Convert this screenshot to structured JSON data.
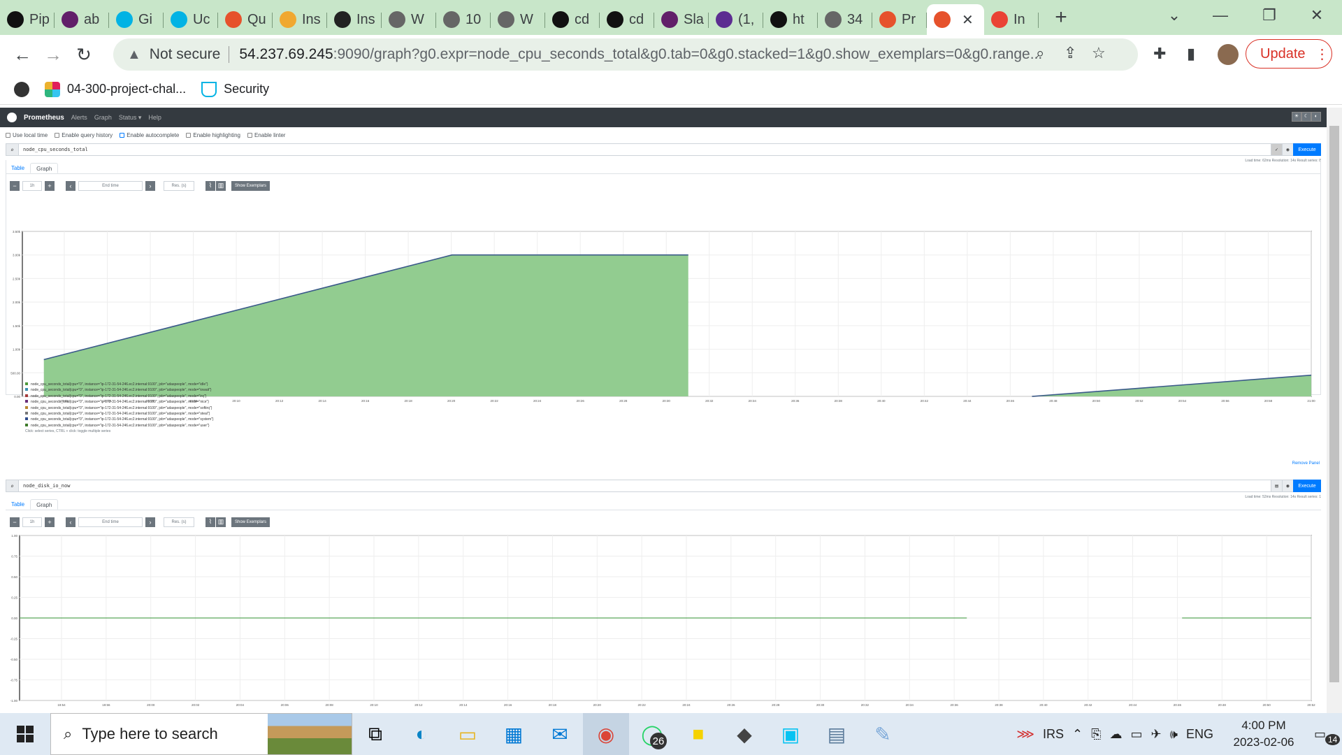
{
  "browser": {
    "tabs": [
      {
        "label": "Pip",
        "icon": "prometheus-like-icon"
      },
      {
        "label": "ab",
        "icon": "slack-icon"
      },
      {
        "label": "Gi",
        "icon": "udacity-icon"
      },
      {
        "label": "Uc",
        "icon": "udacity-icon"
      },
      {
        "label": "Qu",
        "icon": "prometheus-icon"
      },
      {
        "label": "Ins",
        "icon": "aws-box-icon"
      },
      {
        "label": "Ins",
        "icon": "terminal-icon"
      },
      {
        "label": "W",
        "icon": "globe-icon"
      },
      {
        "label": "10",
        "icon": "globe-icon"
      },
      {
        "label": "W",
        "icon": "globe-icon"
      },
      {
        "label": "cd",
        "icon": "github-icon"
      },
      {
        "label": "cd",
        "icon": "github-icon"
      },
      {
        "label": "Sla",
        "icon": "slack-icon"
      },
      {
        "label": "(1,",
        "icon": "mail-icon"
      },
      {
        "label": "ht",
        "icon": "k-icon"
      },
      {
        "label": "34",
        "icon": "globe-icon"
      },
      {
        "label": "Pr",
        "icon": "prometheus-icon"
      },
      {
        "label": "",
        "icon": "prometheus-icon"
      },
      {
        "label": "In",
        "icon": "gmail-icon"
      }
    ],
    "new_tab": "+",
    "omnibox": {
      "security": "Not secure",
      "host": "54.237.69.245",
      "rest": ":9090/graph?g0.expr=node_cpu_seconds_total&g0.tab=0&g0.stacked=1&g0.show_exemplars=0&g0.range..."
    },
    "update_label": "Update",
    "bookmarks": [
      {
        "label": "",
        "icon": "globe-icon"
      },
      {
        "label": "04-300-project-chal...",
        "icon": "slack-icon"
      },
      {
        "label": "Security",
        "icon": "udacity-icon"
      }
    ]
  },
  "prometheus": {
    "nav": {
      "brand": "Prometheus",
      "links": [
        "Alerts",
        "Graph",
        "Status ▾",
        "Help"
      ]
    },
    "options": [
      "Use local time",
      "Enable query history",
      "Enable autocomplete",
      "Enable highlighting",
      "Enable linter"
    ],
    "panels": [
      {
        "query": "node_cpu_seconds_total",
        "execute": "Execute",
        "stats": "Load time: 62ms   Resolution: 14s   Result series: 8",
        "tabs": [
          "Table",
          "Graph"
        ],
        "range": "1h",
        "end_time_placeholder": "End time",
        "res_placeholder": "Res. (s)",
        "exemplars": "Show Exemplars",
        "legend": [
          {
            "text": "node_cpu_seconds_total{cpu=\"0\", instance=\"ip-172-31-54-246.ec2.internal:9100\", job=\"udaspeople\", mode=\"idle\"}",
            "color": "#4e9a3c"
          },
          {
            "text": "node_cpu_seconds_total{cpu=\"0\", instance=\"ip-172-31-54-246.ec2.internal:9100\", job=\"udaspeople\", mode=\"iowait\"}",
            "color": "#3a8fb0"
          },
          {
            "text": "node_cpu_seconds_total{cpu=\"0\", instance=\"ip-172-31-54-246.ec2.internal:9100\", job=\"udaspeople\", mode=\"irq\"}",
            "color": "#a63c3c"
          },
          {
            "text": "node_cpu_seconds_total{cpu=\"0\", instance=\"ip-172-31-54-246.ec2.internal:9100\", job=\"udaspeople\", mode=\"nice\"}",
            "color": "#6a2f7a"
          },
          {
            "text": "node_cpu_seconds_total{cpu=\"0\", instance=\"ip-172-31-54-246.ec2.internal:9100\", job=\"udaspeople\", mode=\"softirq\"}",
            "color": "#b8872f"
          },
          {
            "text": "node_cpu_seconds_total{cpu=\"0\", instance=\"ip-172-31-54-246.ec2.internal:9100\", job=\"udaspeople\", mode=\"steal\"}",
            "color": "#777777"
          },
          {
            "text": "node_cpu_seconds_total{cpu=\"0\", instance=\"ip-172-31-54-246.ec2.internal:9100\", job=\"udaspeople\", mode=\"system\"}",
            "color": "#2d4a8a"
          },
          {
            "text": "node_cpu_seconds_total{cpu=\"0\", instance=\"ip-172-31-54-246.ec2.internal:9100\", job=\"udaspeople\", mode=\"user\"}",
            "color": "#3d7a2a"
          }
        ],
        "legend_hint": "Click: select series, CTRL + click: toggle multiple series",
        "remove": "Remove Panel"
      },
      {
        "query": "node_disk_io_now",
        "execute": "Execute",
        "stats": "Load time: 52ms   Resolution: 14s   Result series: 1",
        "tabs": [
          "Table",
          "Graph"
        ],
        "range": "1h",
        "end_time_placeholder": "End time",
        "res_placeholder": "Res. (s)",
        "exemplars": "Show Exemplars"
      }
    ]
  },
  "chart_data": [
    {
      "type": "area",
      "title": "",
      "x": [
        "20:02",
        "20:04",
        "20:06",
        "20:08",
        "20:10",
        "20:12",
        "20:14",
        "20:16",
        "20:18",
        "20:20",
        "20:22",
        "20:24",
        "20:26",
        "20:28",
        "20:30",
        "20:32",
        "20:34",
        "20:36",
        "20:38",
        "20:40",
        "20:42",
        "20:44",
        "20:46",
        "20:48",
        "20:50",
        "20:52",
        "20:54",
        "20:56",
        "20:58",
        "21:00"
      ],
      "yticks": [
        "0.00",
        "500.00",
        "1.00k",
        "1.50k",
        "2.00k",
        "2.50k",
        "3.00k",
        "3.50k"
      ],
      "ylim": [
        0,
        3500
      ],
      "xlim_min": [
        60,
        120
      ],
      "series": [
        {
          "points": [
            [
              60,
              780
            ],
            [
              1200,
              3000
            ],
            [
              1860,
              3000
            ]
          ]
        },
        {
          "points": [
            [
              2820,
              0
            ],
            [
              3600,
              450
            ]
          ]
        }
      ]
    },
    {
      "type": "line",
      "title": "",
      "x": [
        "19:54",
        "19:56",
        "20:00",
        "20:02",
        "20:04",
        "20:06",
        "20:08",
        "20:10",
        "20:12",
        "20:14",
        "20:16",
        "20:18",
        "20:20",
        "20:22",
        "20:24",
        "20:26",
        "20:28",
        "20:30",
        "20:32",
        "20:34",
        "20:36",
        "20:38",
        "20:40",
        "20:42",
        "20:44",
        "20:46",
        "20:48",
        "20:50",
        "20:52"
      ],
      "yticks": [
        "-1.00",
        "-0.75",
        "-0.50",
        "-0.25",
        "0.00",
        "0.25",
        "0.50",
        "0.75",
        "1.00"
      ],
      "ylim": [
        -1,
        1
      ],
      "series": [
        {
          "points": [
            [
              0,
              0
            ],
            [
              2640,
              0
            ]
          ]
        },
        {
          "points": [
            [
              3240,
              0
            ],
            [
              3600,
              0
            ]
          ]
        }
      ]
    }
  ],
  "taskbar": {
    "search_placeholder": "Type here to search",
    "whatsapp_badge": "26",
    "tray_irs": "IRS",
    "lang": "ENG",
    "time": "4:00 PM",
    "date": "2023-02-06",
    "notif": "14"
  }
}
